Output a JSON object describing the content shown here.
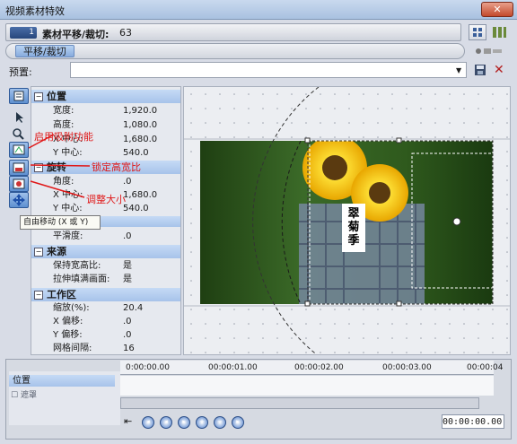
{
  "window": {
    "title": "视频素材特效",
    "close": "✕"
  },
  "header": {
    "badge": "1",
    "title": "素材平移/裁切:",
    "number": "63"
  },
  "chain": {
    "tab": "平移/裁切"
  },
  "preset": {
    "label": "预置:",
    "value": ""
  },
  "tooltip": "自由移动 (X 或 Y)",
  "sections": {
    "position": {
      "title": "位置",
      "rows": [
        {
          "k": "宽度:",
          "v": "1,920.0"
        },
        {
          "k": "高度:",
          "v": "1,080.0"
        },
        {
          "k": "X 中心:",
          "v": "1,680.0"
        },
        {
          "k": "Y 中心:",
          "v": "540.0"
        }
      ]
    },
    "rotation": {
      "title": "旋转",
      "rows": [
        {
          "k": "角度:",
          "v": ".0"
        },
        {
          "k": "X 中心:",
          "v": "1,680.0"
        },
        {
          "k": "Y 中心:",
          "v": "540.0"
        }
      ]
    },
    "smooth": {
      "k": "平滑度:",
      "v": ".0"
    },
    "source": {
      "title": "来源",
      "rows": [
        {
          "k": "保持宽高比:",
          "v": "是"
        },
        {
          "k": "拉伸填满画面:",
          "v": "是"
        }
      ]
    },
    "workspace": {
      "title": "工作区",
      "rows": [
        {
          "k": "缩放(%):",
          "v": "20.4"
        },
        {
          "k": "X 偏移:",
          "v": ".0"
        },
        {
          "k": "Y 偏移:",
          "v": ".0"
        },
        {
          "k": "网格间隔:",
          "v": "16"
        }
      ]
    }
  },
  "annotations": {
    "a1": "启用吸附功能",
    "a2": "锁定高宽比",
    "a3": "调整大小"
  },
  "photo_text": "翠菊季",
  "timeline": {
    "track_label": "位置",
    "mask_label": "遮罩",
    "ticks": [
      "0:00:00.00",
      "00:00:01.00",
      "00:00:02.00",
      "00:00:03.00",
      "00:00:04"
    ],
    "timecode": "00:00:00.00"
  },
  "colors": {
    "accent": "#5e8fd0",
    "annotation": "#e01818",
    "section": "#a7c3ea"
  }
}
